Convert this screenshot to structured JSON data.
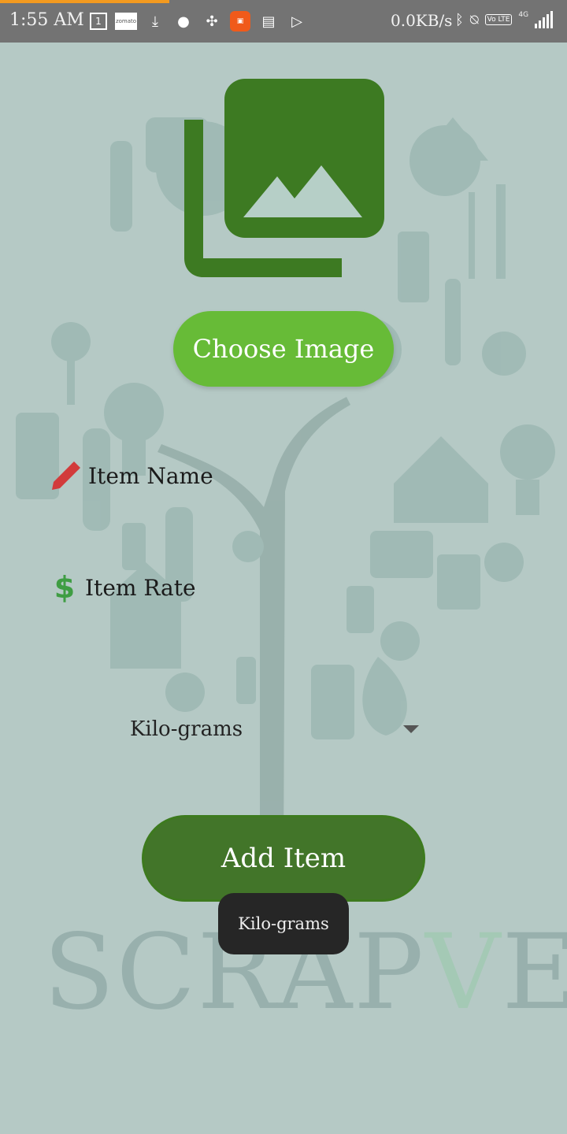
{
  "status_bar": {
    "time": "1:55 AM",
    "net_speed": "0.0KB/s",
    "network_type": "4G",
    "icons_left": [
      "calendar-1-icon",
      "zomato-icon",
      "download-icon",
      "swiggy-icon",
      "pinwheel-icon",
      "app-orange-icon",
      "calendar-icon",
      "play-store-icon"
    ],
    "icons_right": [
      "bluetooth-icon",
      "alarm-off-icon",
      "volte-icon",
      "signal-icon"
    ],
    "calendar_day": "1",
    "zomato_text": "zomato",
    "volte_text": "Vo LTE"
  },
  "form": {
    "choose_image_label": "Choose Image",
    "item_name_placeholder": "Item Name",
    "item_rate_placeholder": "Item Rate",
    "unit_selected": "Kilo-grams",
    "add_item_label": "Add Item"
  },
  "toast": {
    "text": "Kilo-grams"
  },
  "watermark": {
    "text_part1": "SCRAP",
    "text_part2": "V",
    "text_part3": "END"
  },
  "colors": {
    "background": "#b5c9c5",
    "choose_button": "#67bb37",
    "add_button": "#427529",
    "image_icon": "#3d7a22",
    "pencil": "#d23b3b",
    "dollar": "#3f9d43"
  }
}
